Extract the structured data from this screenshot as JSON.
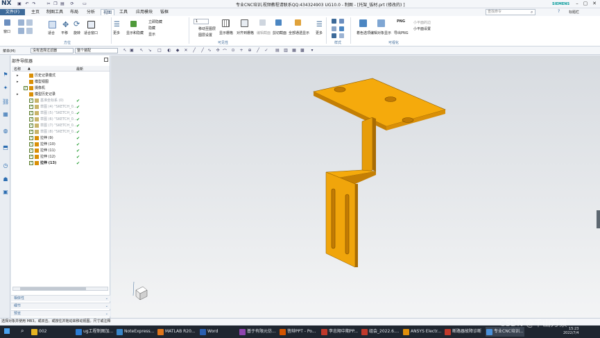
{
  "app": {
    "logo": "NX",
    "window_title": "专业CNC培训,视频教程请联系QQ:434324903 UG10.0 - 制图 - [托架_钣材.prt  (修改的) ]",
    "brand": "SIEMENS"
  },
  "menu": {
    "file": "文件(F)",
    "tabs": [
      "主页",
      "制图工具",
      "布局",
      "分析",
      "视图",
      "工具",
      "应用模块",
      "钣框"
    ],
    "active_tab": "视图",
    "search_placeholder": "查找命令",
    "right_items": [
      "标题栏"
    ]
  },
  "ribbon": {
    "group1": {
      "label": "方位",
      "items": [
        "窗口",
        "适合",
        "平移",
        "缩放",
        "旋转",
        "适合窗口"
      ]
    },
    "group2": {
      "items": [
        "更多",
        "显示和隐藏",
        "立即隐藏",
        "隐藏",
        "显示"
      ]
    },
    "group3": {
      "label": "可见性",
      "layer_value": "1",
      "items": [
        "移动至图层",
        "图层设置",
        "显示栅格",
        "对齐到栅格",
        "编辑截面",
        "剪切截面",
        "全部通透显示",
        "更多"
      ]
    },
    "group4": {
      "label": "样式",
      "items": [
        "真实着色"
      ]
    },
    "group5": {
      "label": "可视化",
      "items": [
        "着色选项",
        "编辑对象显示",
        "导出PNG",
        "PNG",
        "小平面的边",
        "小平面设置"
      ]
    }
  },
  "toolbar": {
    "menu_label": "菜单(M)",
    "filter": "没有选择过滤器",
    "scope": "整个装配"
  },
  "navigator": {
    "title": "部件导航器",
    "col_name": "名称",
    "col_latest": "最新",
    "rows": [
      {
        "label": "历史记录模式",
        "style": "normal",
        "indent": 1,
        "check": false,
        "tick": false
      },
      {
        "label": "模型视图",
        "style": "normal",
        "indent": 1,
        "check": false,
        "tick": false
      },
      {
        "label": "摄像机",
        "style": "normal",
        "indent": 1,
        "check": true,
        "tick": false
      },
      {
        "label": "模型历史记录",
        "style": "normal",
        "indent": 1,
        "check": false,
        "tick": false
      },
      {
        "label": "基准坐标系 (0)",
        "style": "grey",
        "indent": 2,
        "check": true,
        "tick": true
      },
      {
        "label": "草图 (4) \"SKETCH_0...",
        "style": "grey",
        "indent": 2,
        "check": true,
        "tick": true
      },
      {
        "label": "草图 (5) \"SKETCH_0...",
        "style": "grey",
        "indent": 2,
        "check": true,
        "tick": true
      },
      {
        "label": "草图 (6) \"SKETCH_0...",
        "style": "grey",
        "indent": 2,
        "check": true,
        "tick": true
      },
      {
        "label": "草图 (7) \"SKETCH_0...",
        "style": "grey",
        "indent": 2,
        "check": true,
        "tick": true
      },
      {
        "label": "草图 (8) \"SKETCH_0...",
        "style": "grey",
        "indent": 2,
        "check": true,
        "tick": true
      },
      {
        "label": "拉伸 (9)",
        "style": "normal",
        "indent": 2,
        "check": true,
        "tick": true
      },
      {
        "label": "拉伸 (10)",
        "style": "normal",
        "indent": 2,
        "check": true,
        "tick": true
      },
      {
        "label": "拉伸 (11)",
        "style": "normal",
        "indent": 2,
        "check": true,
        "tick": true
      },
      {
        "label": "拉伸 (12)",
        "style": "normal",
        "indent": 2,
        "check": true,
        "tick": true
      },
      {
        "label": "拉伸 (13)",
        "style": "bold",
        "indent": 2,
        "check": true,
        "tick": true
      }
    ],
    "accordion": [
      "相依性",
      "细节",
      "预览"
    ]
  },
  "status": "选择对象并使用 MB3，或双击。或按住并拖动来移动视图。尺寸或注释",
  "taskbar": {
    "items": [
      "002",
      "ug工程制图加...",
      "NoteExpress...",
      "MATLAB R20...",
      "Word",
      "基于有限元仿...",
      "答辩PPT - Po...",
      "李忠翔中期PP...",
      "组会_2022.6....",
      "ANSYS Electr...",
      "断路器故障诊断",
      "专业CNC培训..."
    ],
    "time": "15:23",
    "date": "2022/7/4"
  },
  "watermark": "CSDN @千山万景",
  "colors": {
    "part": "#f2a70a",
    "part_dark": "#c9860a",
    "accent": "#3d6a99"
  }
}
